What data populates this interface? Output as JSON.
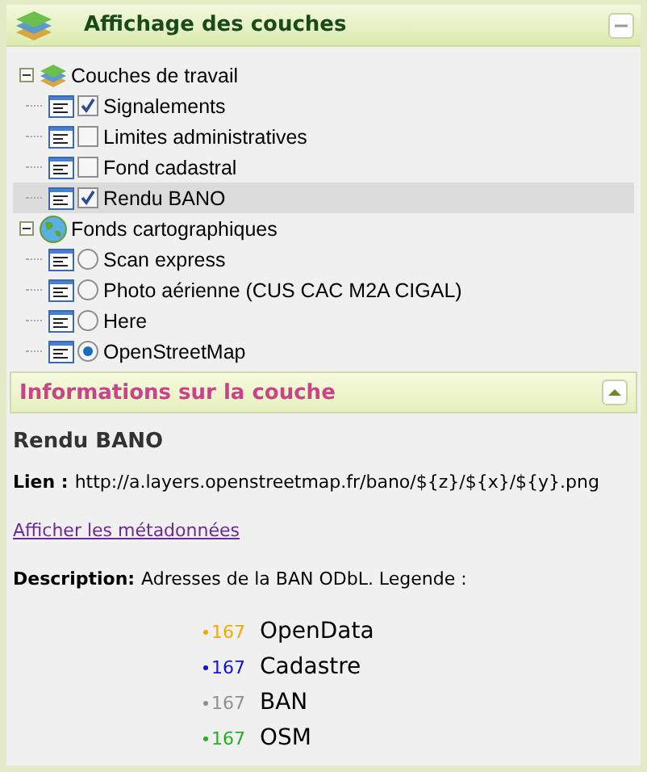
{
  "layers_panel": {
    "title": "Affichage des couches",
    "expanded": true,
    "groups": [
      {
        "label": "Couches de travail",
        "kind": "layers",
        "expanded": true,
        "children": [
          {
            "label": "Signalements",
            "kind": "checkbox",
            "checked": true,
            "selected": false
          },
          {
            "label": "Limites administratives",
            "kind": "checkbox",
            "checked": false,
            "selected": false
          },
          {
            "label": "Fond cadastral",
            "kind": "checkbox",
            "checked": false,
            "selected": false
          },
          {
            "label": "Rendu BANO",
            "kind": "checkbox",
            "checked": true,
            "selected": true
          }
        ]
      },
      {
        "label": "Fonds cartographiques",
        "kind": "globe",
        "expanded": true,
        "children": [
          {
            "label": "Scan express",
            "kind": "radio",
            "checked": false,
            "selected": false
          },
          {
            "label": "Photo aérienne (CUS CAC M2A CIGAL)",
            "kind": "radio",
            "checked": false,
            "selected": false
          },
          {
            "label": "Here",
            "kind": "radio",
            "checked": false,
            "selected": false
          },
          {
            "label": "OpenStreetMap",
            "kind": "radio",
            "checked": true,
            "selected": false
          }
        ]
      }
    ]
  },
  "info_panel": {
    "title": "Informations sur la couche",
    "expanded": true,
    "layer_name": "Rendu BANO",
    "link_label": "Lien :",
    "link_url": "http://a.layers.openstreetmap.fr/bano/${z}/${x}/${y}.png",
    "metadata_link": "Afficher les métadonnées",
    "description_label": "Description:",
    "description": "Adresses de la BAN ODbL. Legende :",
    "legend": [
      {
        "count": "167",
        "label": "OpenData",
        "color": "#f5a800"
      },
      {
        "count": "167",
        "label": "Cadastre",
        "color": "#1010e0"
      },
      {
        "count": "167",
        "label": "BAN",
        "color": "#909090"
      },
      {
        "count": "167",
        "label": "OSM",
        "color": "#20b020"
      }
    ]
  }
}
